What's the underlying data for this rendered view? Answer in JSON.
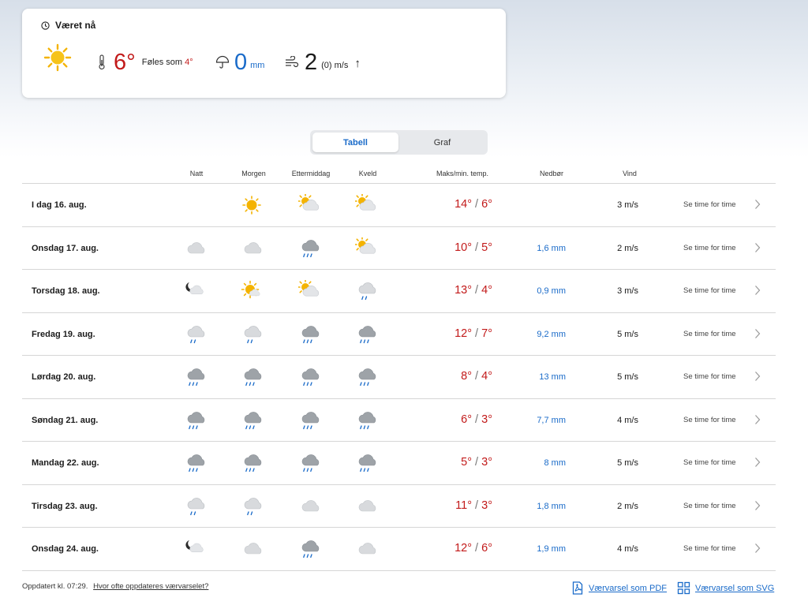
{
  "now": {
    "title": "Været nå",
    "temperature": "6°",
    "feels_like_label": "Føles som",
    "feels_like_value": "4°",
    "precip_value": "0",
    "precip_unit": "mm",
    "wind_value": "2",
    "wind_unit": "(0) m/s",
    "wind_direction_arrow": "↑"
  },
  "tabs": {
    "table": "Tabell",
    "graph": "Graf"
  },
  "columns": {
    "night": "Natt",
    "morning": "Morgen",
    "afternoon": "Ettermiddag",
    "evening": "Kveld",
    "temp": "Maks/min. temp.",
    "precip": "Nedbør",
    "wind": "Vind"
  },
  "see_hourly_label": "Se time for time",
  "colors": {
    "temp_red": "#c21a1a",
    "precip_blue": "#1a6bc9",
    "sun": "#f4b300",
    "cloud": "#d8dadd",
    "dark_cloud": "#9ea3a8"
  },
  "forecast": [
    {
      "day": "I dag 16. aug.",
      "icons": [
        "",
        "sun",
        "partly-cloudy",
        "partly-cloudy"
      ],
      "max": "14°",
      "min": "6°",
      "precip": "",
      "wind": "3 m/s"
    },
    {
      "day": "Onsdag 17. aug.",
      "icons": [
        "cloudy",
        "cloudy",
        "rain",
        "partly-cloudy"
      ],
      "max": "10°",
      "min": "5°",
      "precip": "1,6 mm",
      "wind": "2 m/s"
    },
    {
      "day": "Torsdag 18. aug.",
      "icons": [
        "night-partly-cloudy",
        "fair",
        "partly-cloudy",
        "light-rain"
      ],
      "max": "13°",
      "min": "4°",
      "precip": "0,9 mm",
      "wind": "3 m/s"
    },
    {
      "day": "Fredag 19. aug.",
      "icons": [
        "light-rain",
        "light-rain",
        "rain",
        "rain"
      ],
      "max": "12°",
      "min": "7°",
      "precip": "9,2 mm",
      "wind": "5 m/s"
    },
    {
      "day": "Lørdag 20. aug.",
      "icons": [
        "rain",
        "rain",
        "rain",
        "rain"
      ],
      "max": "8°",
      "min": "4°",
      "precip": "13 mm",
      "wind": "5 m/s"
    },
    {
      "day": "Søndag 21. aug.",
      "icons": [
        "rain",
        "rain",
        "rain",
        "rain"
      ],
      "max": "6°",
      "min": "3°",
      "precip": "7,7 mm",
      "wind": "4 m/s"
    },
    {
      "day": "Mandag 22. aug.",
      "icons": [
        "rain",
        "rain",
        "rain",
        "rain"
      ],
      "max": "5°",
      "min": "3°",
      "precip": "8 mm",
      "wind": "5 m/s"
    },
    {
      "day": "Tirsdag 23. aug.",
      "icons": [
        "light-rain",
        "light-rain",
        "cloudy",
        "cloudy"
      ],
      "max": "11°",
      "min": "3°",
      "precip": "1,8 mm",
      "wind": "2 m/s"
    },
    {
      "day": "Onsdag 24. aug.",
      "icons": [
        "night-partly-cloudy",
        "cloudy",
        "rain",
        "cloudy"
      ],
      "max": "12°",
      "min": "6°",
      "precip": "1,9 mm",
      "wind": "4 m/s"
    }
  ],
  "footer": {
    "updated": "Oppdatert kl. 07:29.",
    "how_often_link": "Hvor ofte oppdateres værvarselet?",
    "pdf_link": "Værvarsel som PDF",
    "svg_link": "Værvarsel som SVG"
  }
}
